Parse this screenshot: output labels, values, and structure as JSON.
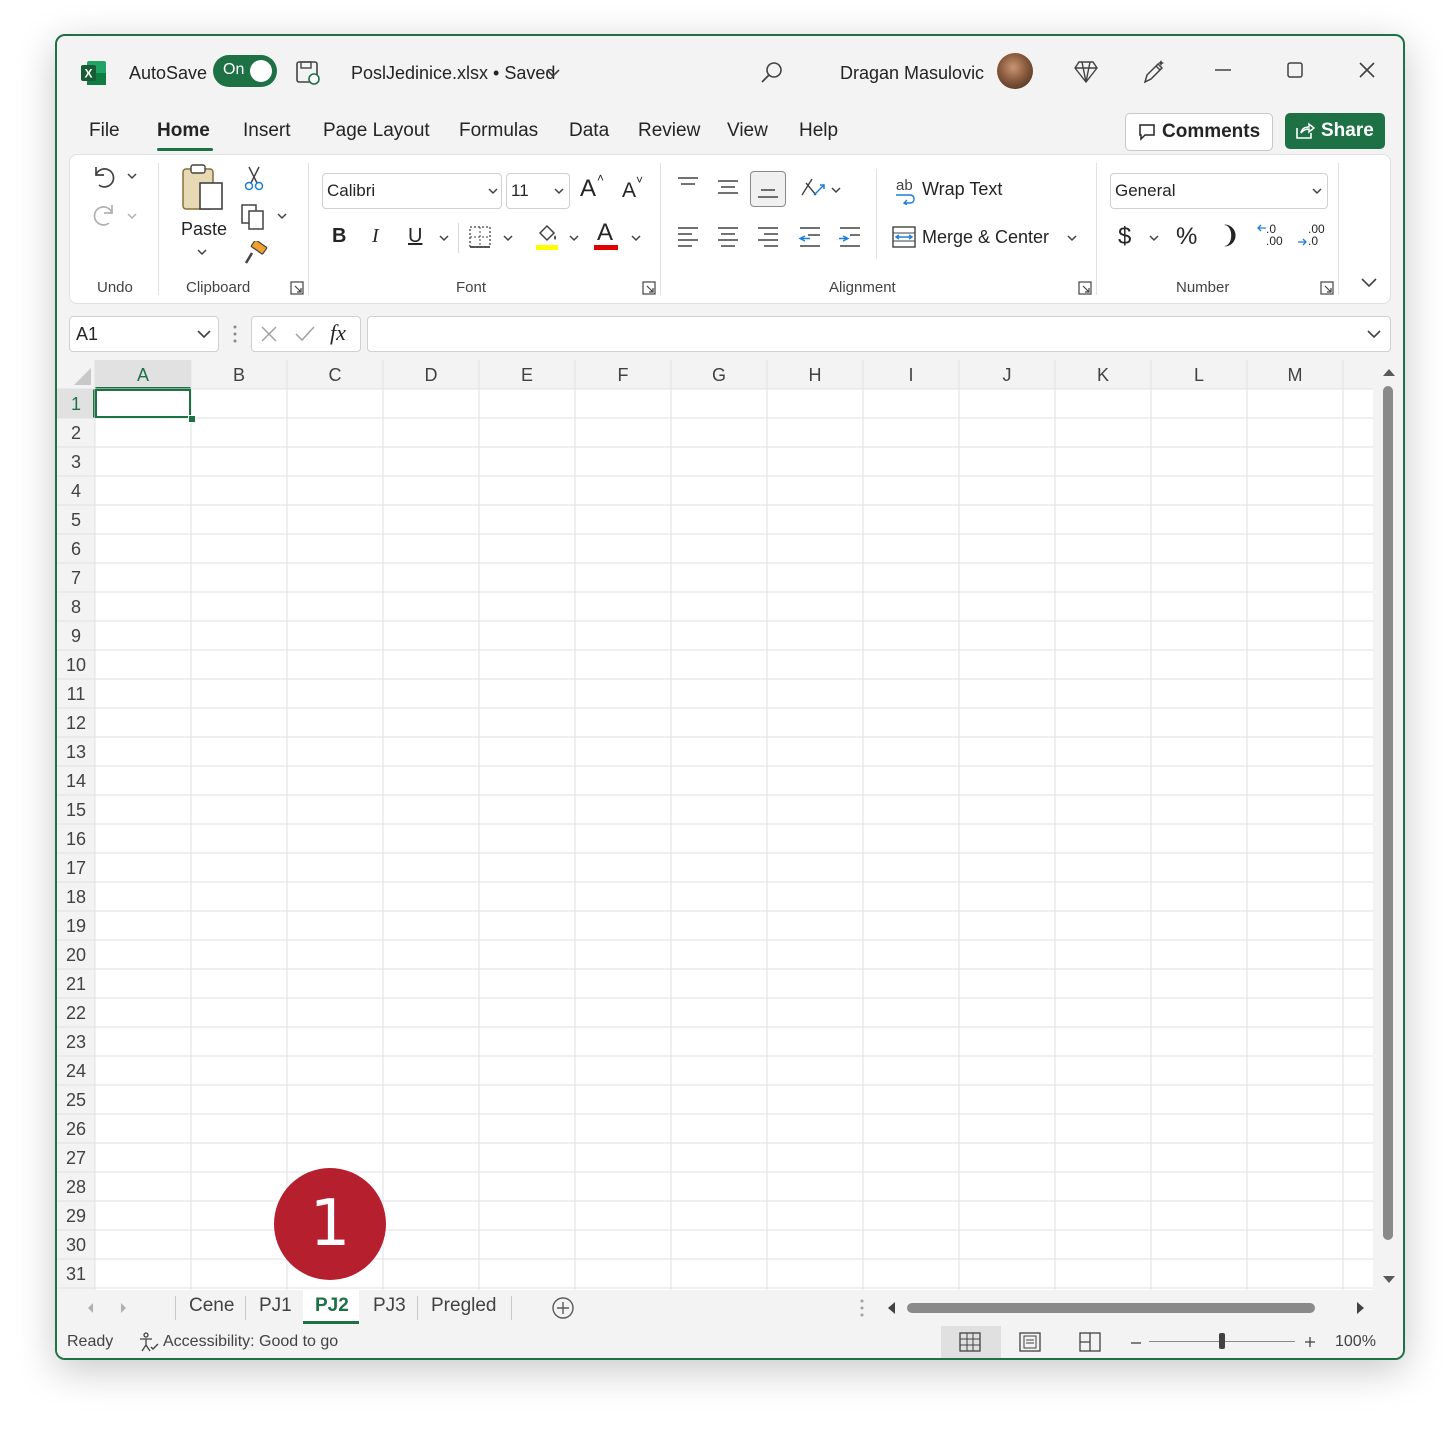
{
  "titlebar": {
    "autosave_label": "AutoSave",
    "autosave_state": "On",
    "filename": "PoslJedinice.xlsx • Saved",
    "user_name": "Dragan Masulovic",
    "accent": "#1e7145"
  },
  "menu": {
    "items": [
      "File",
      "Home",
      "Insert",
      "Page Layout",
      "Formulas",
      "Data",
      "Review",
      "View",
      "Help"
    ],
    "active": "Home",
    "comments_label": "Comments",
    "share_label": "Share"
  },
  "ribbon": {
    "groups": {
      "undo": "Undo",
      "clipboard": "Clipboard",
      "font": "Font",
      "alignment": "Alignment",
      "number": "Number"
    },
    "paste_label": "Paste",
    "font_name": "Calibri",
    "font_size": "11",
    "bold": "B",
    "italic": "I",
    "underline": "U",
    "grow_font": "A",
    "shrink_font": "A",
    "font_color_letter": "A",
    "wrap_text": "Wrap Text",
    "wrap_icon_text": "ab",
    "merge_center": "Merge & Center",
    "number_format": "General",
    "currency": "$",
    "percent": "%",
    "comma": "❩",
    "inc_decimal": ".00",
    "dec_decimal": ".0",
    "fill_color": "#ffff00",
    "font_color": "#e00000"
  },
  "formula_bar": {
    "name_box": "A1",
    "fx_label": "fx",
    "formula": ""
  },
  "grid": {
    "columns": [
      "A",
      "B",
      "C",
      "D",
      "E",
      "F",
      "G",
      "H",
      "I",
      "J",
      "K",
      "L",
      "M"
    ],
    "rows": [
      "1",
      "2",
      "3",
      "4",
      "5",
      "6",
      "7",
      "8",
      "9",
      "10",
      "11",
      "12",
      "13",
      "14",
      "15",
      "16",
      "17",
      "18",
      "19",
      "20",
      "21",
      "22",
      "23",
      "24",
      "25",
      "26",
      "27",
      "28",
      "29",
      "30",
      "31"
    ],
    "selected_cell": "A1"
  },
  "sheets": {
    "tabs": [
      "Cene",
      "PJ1",
      "PJ2",
      "PJ3",
      "Pregled"
    ],
    "active": "PJ2"
  },
  "status": {
    "ready": "Ready",
    "accessibility": "Accessibility: Good to go",
    "zoom": "100%"
  },
  "callout": {
    "number": "1"
  }
}
